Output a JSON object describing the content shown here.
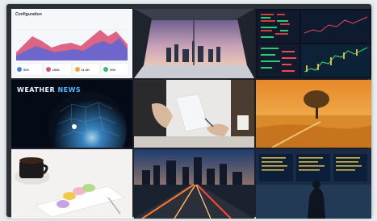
{
  "dashboard": {
    "title": "Configuration",
    "stats": [
      {
        "icon": "user-icon",
        "value": "600",
        "color": "#4a7fd6"
      },
      {
        "icon": "calendar-icon",
        "value": "1553",
        "color": "#e0507a"
      },
      {
        "icon": "wallet-icon",
        "value": "11.0K",
        "color": "#f0a33a"
      },
      {
        "icon": "chart-icon",
        "value": "500",
        "color": "#2fbf71"
      }
    ],
    "colors": {
      "series_a": "#d94a6e",
      "series_b": "#5a66d6"
    }
  },
  "weather": {
    "word1": "WEATHER",
    "word2": "NEWS"
  }
}
